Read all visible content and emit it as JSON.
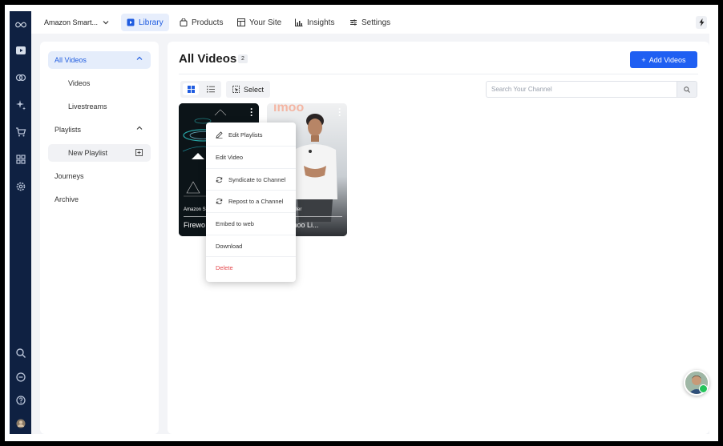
{
  "account": {
    "name": "Amazon Smart..."
  },
  "nav": [
    {
      "label": "Library",
      "icon": "play-square-icon",
      "active": true
    },
    {
      "label": "Products",
      "icon": "bag-icon",
      "active": false
    },
    {
      "label": "Your Site",
      "icon": "layout-icon",
      "active": false
    },
    {
      "label": "Insights",
      "icon": "bar-chart-icon",
      "active": false
    },
    {
      "label": "Settings",
      "icon": "sliders-icon",
      "active": false
    }
  ],
  "sidebar": {
    "items": [
      {
        "label": "All Videos",
        "active": true
      },
      {
        "label": "Videos"
      },
      {
        "label": "Livestreams"
      },
      {
        "label": "Playlists"
      },
      {
        "label": "New Playlist"
      },
      {
        "label": "Journeys"
      },
      {
        "label": "Archive"
      }
    ]
  },
  "main": {
    "title": "All Videos",
    "count": "2",
    "add_button": "Add Videos",
    "select_label": "Select",
    "search_placeholder": "Search Your Channel"
  },
  "videos": [
    {
      "author": "Amazon S",
      "title": "Firewo"
    },
    {
      "author": "martBiz Seller",
      "title": "ence imoo Li..."
    }
  ],
  "context_menu": [
    {
      "label": "Edit Playlists",
      "icon": "pencil-icon"
    },
    {
      "label": "Edit Video",
      "icon": ""
    },
    {
      "label": "Syndicate to Channel",
      "icon": "sync-icon"
    },
    {
      "label": "Repost to a Channel",
      "icon": "sync-icon"
    },
    {
      "label": "Embed to web",
      "icon": ""
    },
    {
      "label": "Download",
      "icon": ""
    },
    {
      "label": "Delete",
      "icon": "",
      "danger": true
    }
  ],
  "colors": {
    "rail": "#0f2142",
    "accent": "#1f5ff2",
    "danger": "#e5484d"
  }
}
